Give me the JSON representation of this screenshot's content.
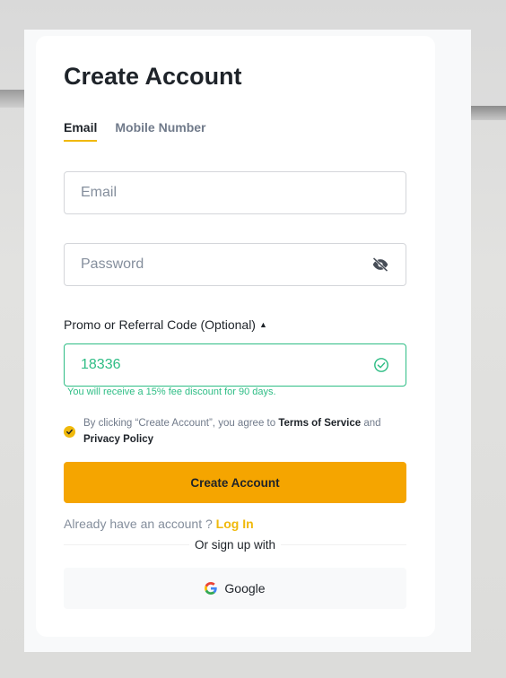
{
  "page": {
    "title": "Create Account"
  },
  "tabs": [
    {
      "label": "Email",
      "active": true
    },
    {
      "label": "Mobile Number",
      "active": false
    }
  ],
  "form": {
    "email_placeholder": "Email",
    "password_placeholder": "Password",
    "promo_label": "Promo or Referral Code (Optional)",
    "promo_value": "18336",
    "promo_hint": "You will receive a 15% fee discount for 90 days."
  },
  "agreement": {
    "prefix": "By clicking “Create Account”, you agree to ",
    "terms": "Terms of Service",
    "and": " and",
    "privacy": "Privacy Policy",
    "checked": true
  },
  "actions": {
    "create_label": "Create Account",
    "already_text": "Already have an account ? ",
    "login_label": "Log In",
    "or_text": "Or sign up with",
    "google_label": "Google"
  },
  "colors": {
    "accent": "#F0B90B",
    "primary_button": "#F5A500",
    "success": "#2EBD85"
  },
  "icons": {
    "password_toggle": "eye-off-icon",
    "promo_valid": "check-circle-icon",
    "caret": "caret-up-icon",
    "google": "google-logo-icon"
  }
}
